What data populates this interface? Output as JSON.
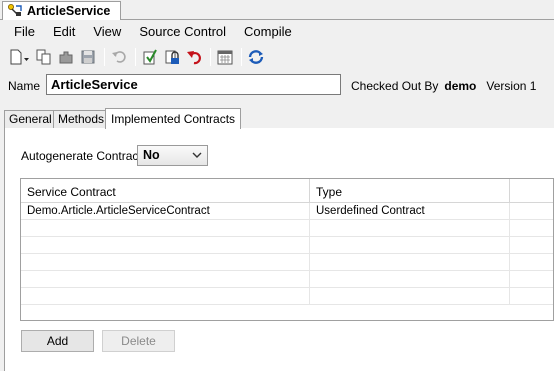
{
  "document_tab": {
    "title": "ArticleService",
    "icon": "service-icon"
  },
  "menu": {
    "items": [
      "File",
      "Edit",
      "View",
      "Source Control",
      "Compile"
    ]
  },
  "toolbar": {
    "icons": [
      "new-document-icon",
      "copy-icon",
      "plugin-icon",
      "save-icon",
      "undo-icon",
      "check-in-icon",
      "lock-icon",
      "undo-checkout-icon",
      "calendar-icon",
      "compile-icon"
    ]
  },
  "header": {
    "name_label": "Name",
    "name_value": "ArticleService",
    "checked_out_by_label": "Checked Out By",
    "checked_out_user": "demo",
    "version": "Version 1"
  },
  "section_tabs": [
    "General",
    "Methods",
    "Implemented Contracts"
  ],
  "autogenerate": {
    "label": "Autogenerate Contract",
    "value": "No"
  },
  "grid": {
    "columns": [
      "Service Contract",
      "Type",
      ""
    ],
    "rows": [
      [
        "Demo.Article.ArticleServiceContract",
        "Userdefined Contract",
        ""
      ],
      [
        "",
        "",
        ""
      ],
      [
        "",
        "",
        ""
      ],
      [
        "",
        "",
        ""
      ],
      [
        "",
        "",
        ""
      ],
      [
        "",
        "",
        ""
      ]
    ]
  },
  "buttons": {
    "add": "Add",
    "delete": "Delete"
  },
  "colors": {
    "accent": "#1c5bb8",
    "undo_red": "#c4121a"
  }
}
